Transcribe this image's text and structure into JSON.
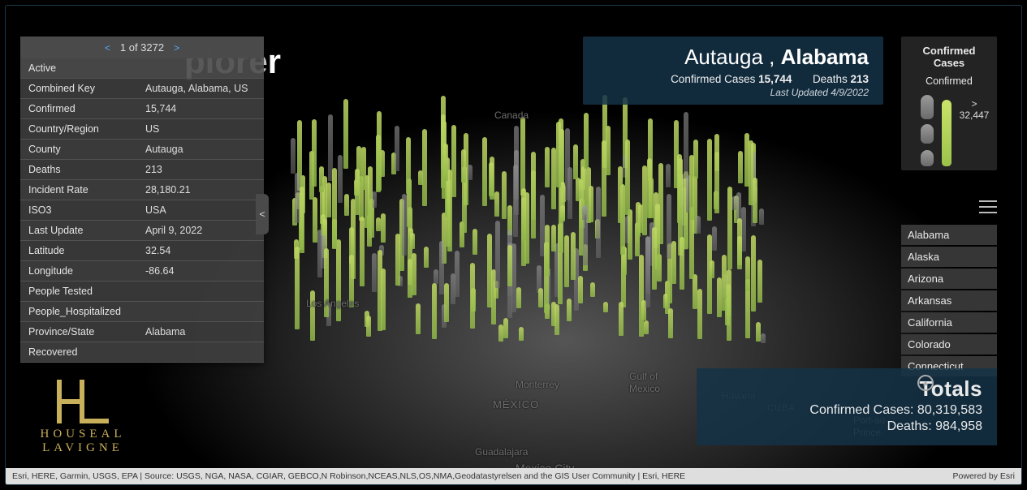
{
  "app": {
    "title": "plorer"
  },
  "popup": {
    "pager_label": "1 of 3272",
    "rows": [
      {
        "k": "Active",
        "v": ""
      },
      {
        "k": "Combined Key",
        "v": "Autauga, Alabama, US"
      },
      {
        "k": "Confirmed",
        "v": "15,744"
      },
      {
        "k": "Country/Region",
        "v": "US"
      },
      {
        "k": "County",
        "v": "Autauga"
      },
      {
        "k": "Deaths",
        "v": "213"
      },
      {
        "k": "Incident Rate",
        "v": "28,180.21"
      },
      {
        "k": "ISO3",
        "v": "USA"
      },
      {
        "k": "Last Update",
        "v": "April 9, 2022"
      },
      {
        "k": "Latitude",
        "v": "32.54"
      },
      {
        "k": "Longitude",
        "v": "-86.64"
      },
      {
        "k": "People Tested",
        "v": ""
      },
      {
        "k": "People_Hospitalized",
        "v": ""
      },
      {
        "k": "Province/State",
        "v": "Alabama"
      },
      {
        "k": "Recovered",
        "v": ""
      }
    ]
  },
  "selection": {
    "county": "Autauga",
    "comma_sep": " , ",
    "state": "Alabama",
    "cc_label": "Confirmed Cases ",
    "cc_value": "15,744",
    "d_label": "Deaths ",
    "d_value": "213",
    "updated": "Last Updated 4/9/2022"
  },
  "legend": {
    "title": "Confirmed Cases",
    "sub": "Confirmed",
    "break_label": "> 32,447"
  },
  "states": {
    "items": [
      "Alabama",
      "Alaska",
      "Arizona",
      "Arkansas",
      "California",
      "Colorado",
      "Connecticut"
    ]
  },
  "totals": {
    "heading": "Totals",
    "cc_label": "Confirmed Cases: ",
    "cc_value": "80,319,583",
    "d_label": "Deaths: ",
    "d_value": "984,958"
  },
  "logo": {
    "l1": "HOUSEAL",
    "l2": "LAVIGNE"
  },
  "map_labels": {
    "los_angeles": "Los Angeles",
    "monterrey": "Monterrey",
    "mexico": "MÉXICO",
    "guadalajara": "Guadalajara",
    "mexico_city": "Mexico City",
    "gulf1": "Gulf of",
    "gulf2": "Mexico",
    "havana": "Havana",
    "cuba": "CUBA",
    "pap1": "Port-au-",
    "pap2": "Prince",
    "canada": "Canada"
  },
  "attribution": {
    "left": "Esri, HERE, Garmin, USGS, EPA | Source: USGS, NGA, NASA, CGIAR, GEBCO,N Robinson,NCEAS,NLS,OS,NMA,Geodatastyrelsen and the GIS User Community | Esri, HERE",
    "right": "Powered by Esri"
  }
}
